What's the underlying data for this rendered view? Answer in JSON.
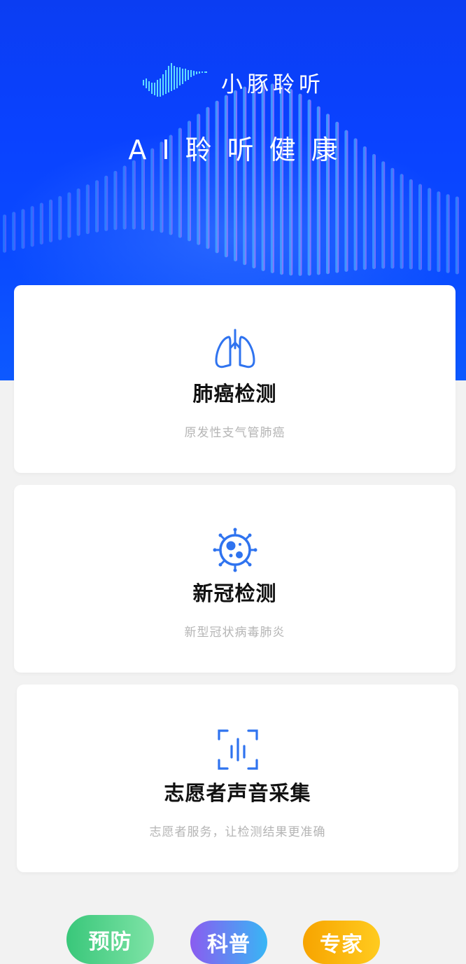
{
  "hero": {
    "brand_name": "小豚聆听",
    "slogan": "AI聆听健康"
  },
  "cards": [
    {
      "title": "肺癌检测",
      "subtitle": "原发性支气管肺癌",
      "icon": "lungs-icon"
    },
    {
      "title": "新冠检测",
      "subtitle": "新型冠状病毒肺炎",
      "icon": "virus-icon"
    },
    {
      "title": "志愿者声音采集",
      "subtitle": "志愿者服务，让检测结果更准确",
      "icon": "voice-scan-icon"
    }
  ],
  "bottom_tabs": [
    {
      "label": "预防"
    },
    {
      "label": "科普"
    },
    {
      "label": "专家"
    }
  ],
  "colors": {
    "hero_blue": "#0a42ff",
    "icon_blue": "#2f73ef",
    "pill_green": "#39c77a",
    "pill_purple": "#8a5cf0",
    "pill_yellow": "#f7a400"
  }
}
